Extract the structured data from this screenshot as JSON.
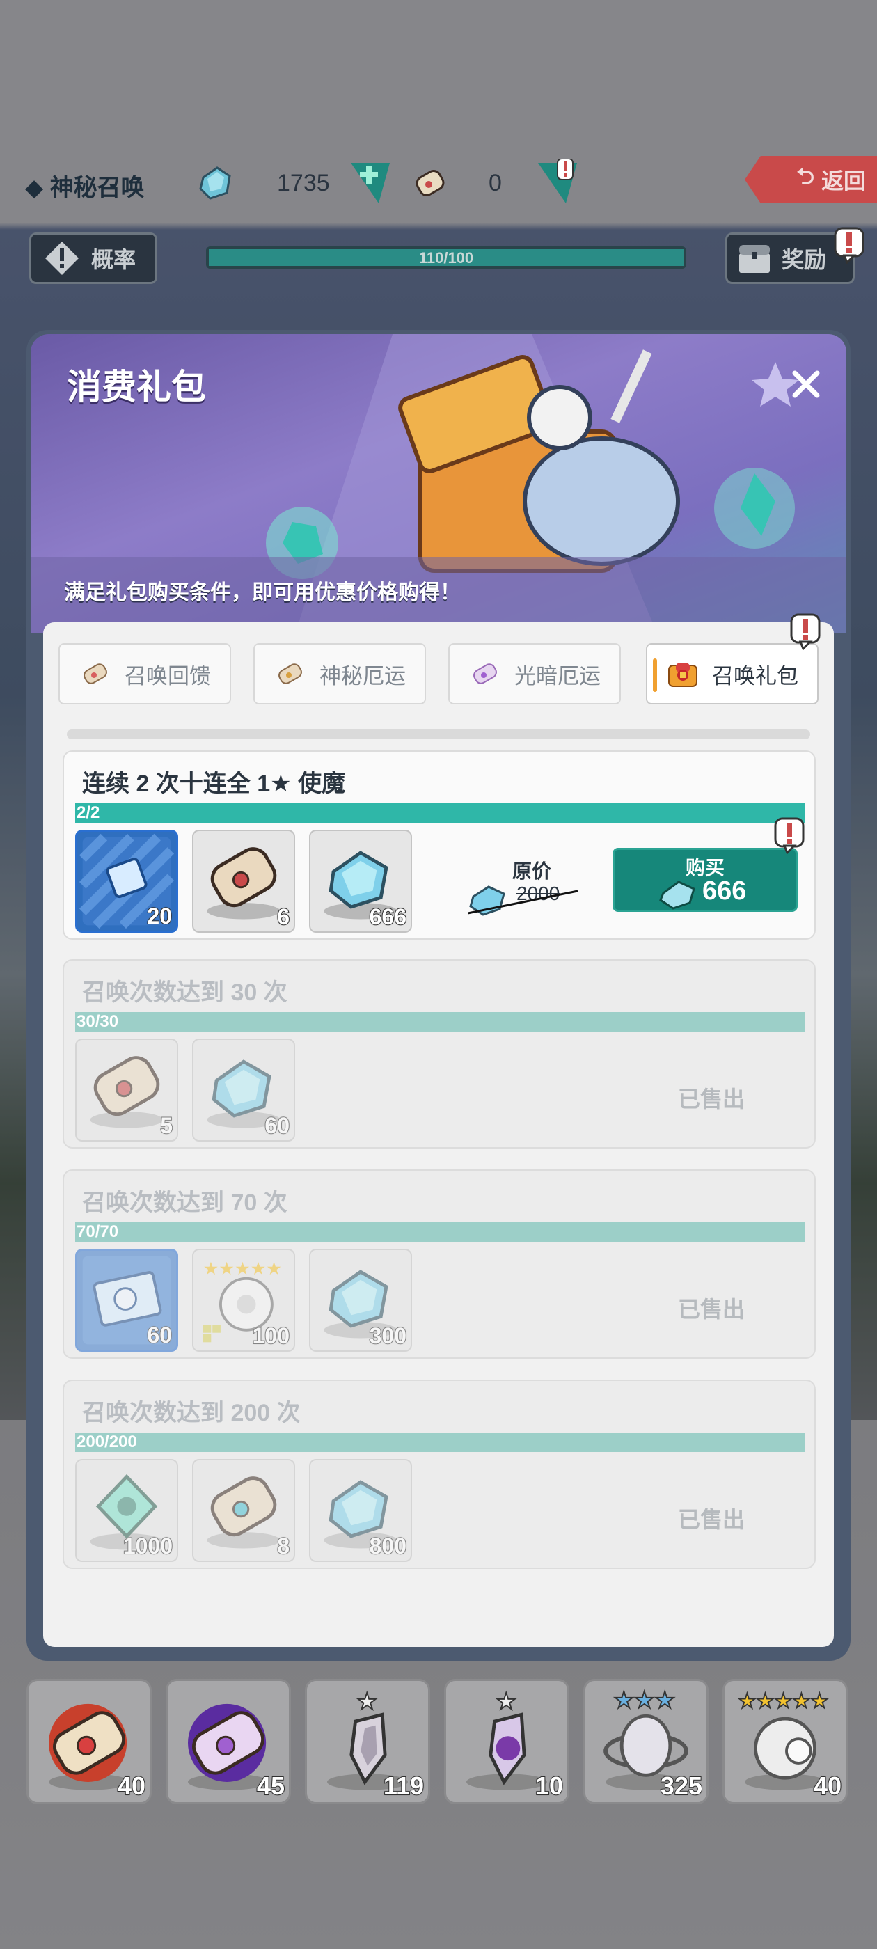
{
  "header": {
    "mode_title": "◆ 神秘召唤",
    "gems": "1735",
    "scrolls": "0",
    "back_label": "返回"
  },
  "row2": {
    "rate_label": "概率",
    "progress_text": "110/100",
    "progress_fraction": 1.0,
    "reward_label": "奖励"
  },
  "dialog": {
    "title": "消费礼包",
    "subtitle": "满足礼包购买条件，即可用优惠价格购得！",
    "tabs": [
      {
        "label": "召唤回馈",
        "icon": "scroll-icon"
      },
      {
        "label": "神秘厄运",
        "icon": "scroll-icon"
      },
      {
        "label": "光暗厄运",
        "icon": "purple-scroll-icon"
      },
      {
        "label": "召唤礼包",
        "icon": "gift-box-icon"
      }
    ],
    "packs": [
      {
        "title": "连续 2 次十连全 1★ 使魔",
        "progress_text": "2/2",
        "items": [
          {
            "icon": "blue-ticket-icon",
            "qty": "20"
          },
          {
            "icon": "scroll-icon",
            "qty": "6"
          },
          {
            "icon": "gem-icon",
            "qty": "666"
          }
        ],
        "orig_label": "原价",
        "orig_price": "2000",
        "buy_label": "购买",
        "buy_price": "666"
      },
      {
        "title": "召唤次数达到 30 次",
        "progress_text": "30/30",
        "items": [
          {
            "icon": "scroll-icon",
            "qty": "5"
          },
          {
            "icon": "gem-icon",
            "qty": "60"
          }
        ],
        "status": "已售出"
      },
      {
        "title": "召唤次数达到 70 次",
        "progress_text": "70/70",
        "items": [
          {
            "icon": "blue-ticket-icon",
            "qty": "60"
          },
          {
            "icon": "five-star-egg-icon",
            "qty": "100"
          },
          {
            "icon": "gem-icon",
            "qty": "300"
          }
        ],
        "status": "已售出"
      },
      {
        "title": "召唤次数达到 200 次",
        "progress_text": "200/200",
        "items": [
          {
            "icon": "green-crystal-icon",
            "qty": "1000"
          },
          {
            "icon": "scroll-icon",
            "qty": "8"
          },
          {
            "icon": "gem-icon",
            "qty": "800"
          }
        ],
        "status": "已售出"
      }
    ]
  },
  "bottom_cards": [
    {
      "icon": "red-scroll-icon",
      "qty": "40"
    },
    {
      "icon": "purple-scroll-icon",
      "qty": "45"
    },
    {
      "icon": "one-star-shard-icon",
      "qty": "119"
    },
    {
      "icon": "one-star-purple-shard-icon",
      "qty": "10"
    },
    {
      "icon": "three-star-egg-icon",
      "qty": "325"
    },
    {
      "icon": "five-star-egg-icon",
      "qty": "40"
    }
  ],
  "colors": {
    "accent_teal": "#16877a",
    "progress_teal": "#2fb7a8",
    "back_red": "#c94a4a",
    "dialog_title_purple": "#7b6fbf"
  }
}
